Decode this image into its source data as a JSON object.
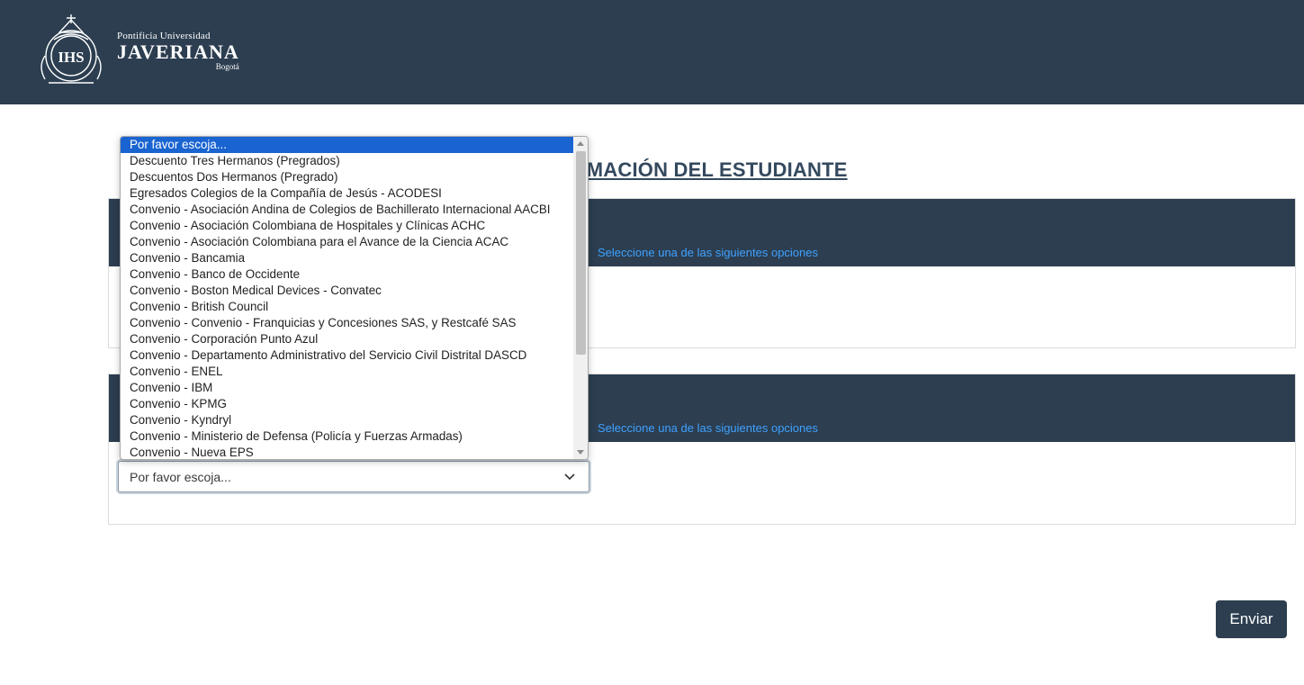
{
  "header": {
    "logo": {
      "line1": "Pontificia Universidad",
      "line2": "JAVERIANA",
      "line3": "Bogotá",
      "emblem_text": "IHS"
    }
  },
  "page_title": "ORMACIÓN DEL ESTUDIANTE",
  "panels": [
    {
      "hint": "Seleccione una de las siguientes opciones"
    },
    {
      "hint": "Seleccione una de las siguientes opciones"
    }
  ],
  "select": {
    "value": "Por favor escoja...",
    "options": [
      "Por favor escoja...",
      "Descuento Tres Hermanos (Pregrados)",
      "Descuentos Dos Hermanos (Pregrado)",
      "Egresados Colegios de la Compañía de Jesús - ACODESI",
      "Convenio - Asociación Andina de Colegios de Bachillerato Internacional AACBI",
      "Convenio - Asociación Colombiana de Hospitales y Clínicas ACHC",
      "Convenio - Asociación Colombiana para el Avance de la Ciencia ACAC",
      "Convenio - Bancamia",
      "Convenio - Banco de Occidente",
      "Convenio - Boston Medical Devices - Convatec",
      "Convenio - British Council",
      "Convenio - Convenio - Franquicias y Concesiones SAS, y Restcafé SAS",
      "Convenio - Corporación Punto Azul",
      "Convenio - Departamento Administrativo del Servicio Civil Distrital DASCD",
      "Convenio - ENEL",
      "Convenio - IBM",
      "Convenio - KPMG",
      "Convenio - Kyndryl",
      "Convenio - Ministerio de Defensa (Policía y Fuerzas Armadas)",
      "Convenio - Nueva EPS"
    ]
  },
  "submit_label": "Enviar",
  "colors": {
    "header_bg": "#2c3e50",
    "hint_text": "#3fa1ff",
    "selected_option": "#1a64d1"
  }
}
